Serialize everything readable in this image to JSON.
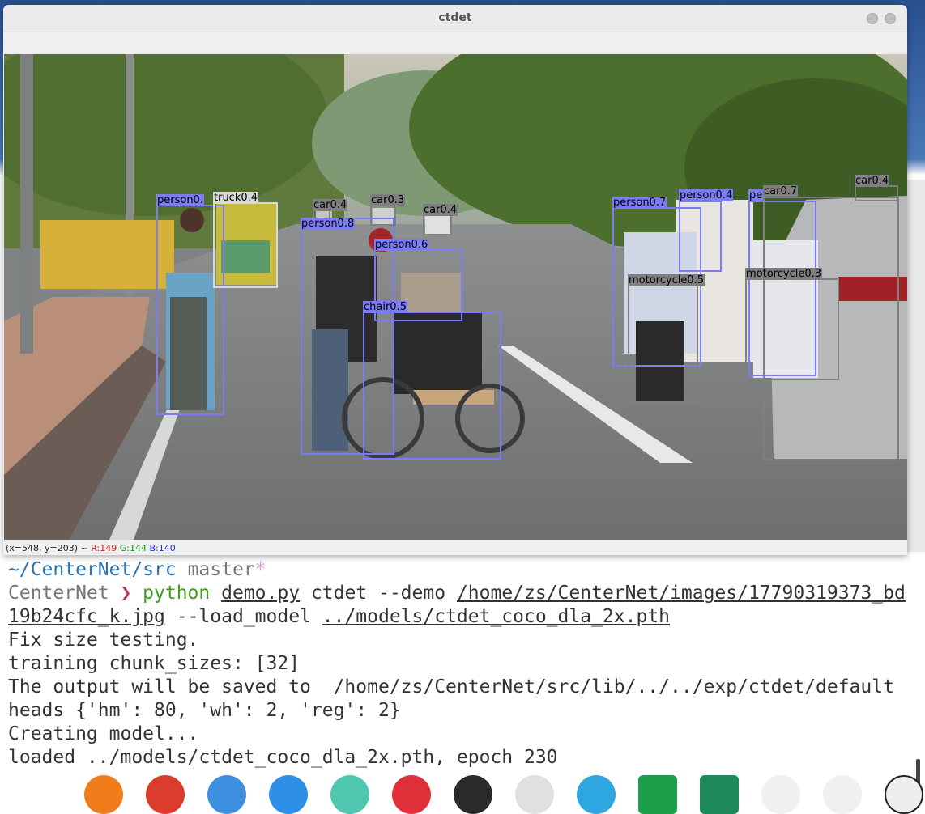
{
  "window": {
    "title": "ctdet"
  },
  "status": {
    "coords": "(x=548, y=203) ~ ",
    "r": "R:149",
    "g": "G:144",
    "b": "B:140"
  },
  "detections": [
    {
      "label": "person0.",
      "color": "#7b7bf5"
    },
    {
      "label": "truck0.4",
      "color": "#d8d8d8"
    },
    {
      "label": "car0.4",
      "color": "#7f7f7f"
    },
    {
      "label": "car0.3",
      "color": "#7f7f7f"
    },
    {
      "label": "car0.4",
      "color": "#7f7f7f"
    },
    {
      "label": "person0.8",
      "color": "#7b7bf5"
    },
    {
      "label": "person0.6",
      "color": "#7b7bf5"
    },
    {
      "label": "chair0.5",
      "color": "#7b7bf5"
    },
    {
      "label": "person0.7",
      "color": "#7b7bf5"
    },
    {
      "label": "person0.4",
      "color": "#7b7bf5"
    },
    {
      "label": "pe",
      "color": "#7b7bf5"
    },
    {
      "label": "car0.7",
      "color": "#7f7f7f"
    },
    {
      "label": "car0.4",
      "color": "#7f7f7f"
    },
    {
      "label": "motorcycle0.5",
      "color": "#7f7f7f"
    },
    {
      "label": "motorcycle0.3",
      "color": "#7f7f7f"
    }
  ],
  "terminal": {
    "prompt_path": "~/CenterNet/src",
    "prompt_branch": " master",
    "prompt_star": "*",
    "env": "CenterNet",
    "arrow": " ❯ ",
    "cmd": "python",
    "script": "demo.py",
    "args1": " ctdet --demo ",
    "image_path_1": "/home/zs/CenterNet/images/17790319373_bd",
    "image_path_2": "19b24cfc_k.jpg",
    "args2": " --load_model ",
    "model_path": "../models/ctdet_coco_dla_2x.pth",
    "out_lines": [
      "Fix size testing.",
      "training chunk_sizes: [32]",
      "The output will be saved to  /home/zs/CenterNet/src/lib/../../exp/ctdet/default",
      "heads {'hm': 80, 'wh': 2, 'reg': 2}",
      "Creating model...",
      "loaded ../models/ctdet_coco_dla_2x.pth, epoch 230"
    ]
  },
  "dock": {
    "icons": [
      "firefox-icon",
      "chrome-icon",
      "finder-icon",
      "appstore-icon",
      "vpn-icon",
      "netease-music-icon",
      "terminal-icon",
      "star-app-icon",
      "telegram-icon",
      "pycharm-icon",
      "clion-icon",
      "bird-app-icon",
      "wine-icon",
      "user-icon"
    ]
  }
}
